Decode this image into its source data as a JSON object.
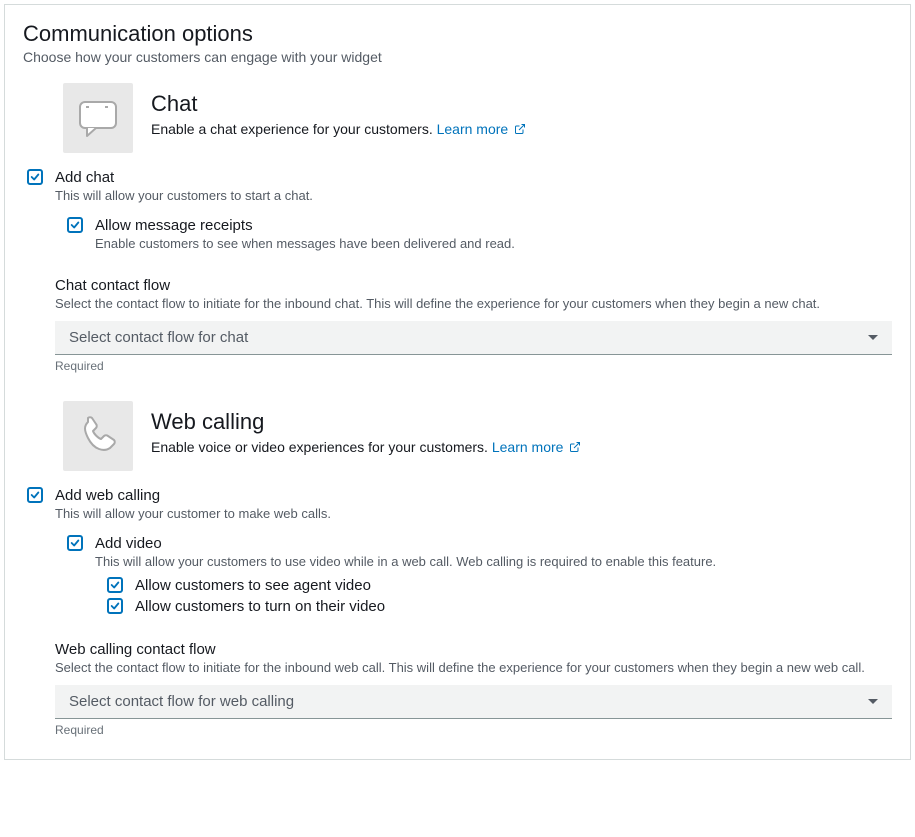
{
  "panel": {
    "title": "Communication options",
    "subtitle": "Choose how your customers can engage with your widget"
  },
  "chat": {
    "title": "Chat",
    "desc": "Enable a chat experience for your customers.",
    "learn_more": "Learn more",
    "add": {
      "label": "Add chat",
      "sub": "This will allow your customers to start a chat."
    },
    "receipts": {
      "label": "Allow message receipts",
      "sub": "Enable customers to see when messages have been delivered and read."
    },
    "flow": {
      "title": "Chat contact flow",
      "desc": "Select the contact flow to initiate for the inbound chat. This will define the experience for your customers when they begin a new chat.",
      "placeholder": "Select contact flow for chat",
      "hint": "Required"
    }
  },
  "webcall": {
    "title": "Web calling",
    "desc": "Enable voice or video experiences for your customers.",
    "learn_more": "Learn more",
    "add": {
      "label": "Add web calling",
      "sub": "This will allow your customer to make web calls."
    },
    "video": {
      "label": "Add video",
      "sub": "This will allow your customers to use video while in a web call. Web calling is required to enable this feature."
    },
    "see_agent": {
      "label": "Allow customers to see agent video"
    },
    "turn_on": {
      "label": "Allow customers to turn on their video"
    },
    "flow": {
      "title": "Web calling contact flow",
      "desc": "Select the contact flow to initiate for the inbound web call. This will define the experience for your customers when they begin a new web call.",
      "placeholder": "Select contact flow for web calling",
      "hint": "Required"
    }
  }
}
